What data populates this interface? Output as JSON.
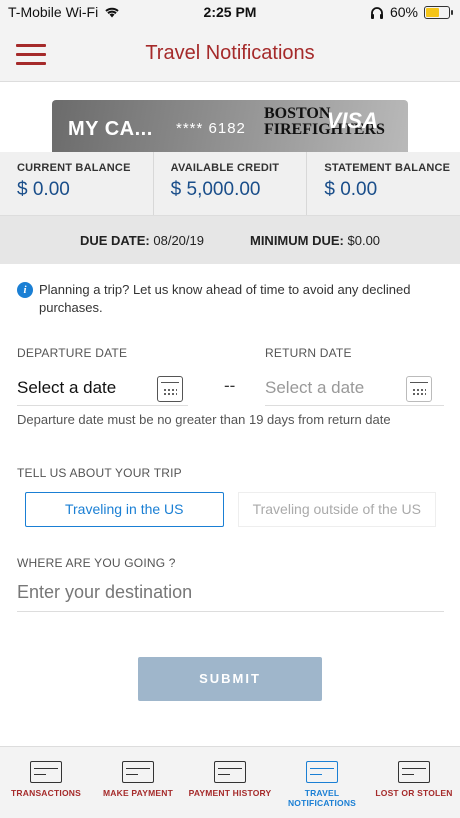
{
  "status_bar": {
    "carrier": "T-Mobile Wi-Fi",
    "time": "2:25 PM",
    "battery": "60%",
    "battery_fill": 0.6
  },
  "header": {
    "title": "Travel Notifications"
  },
  "card": {
    "name": "MY CA...",
    "number": "**** 6182",
    "brand_line1": "BOSTON",
    "brand_line2": "FIREFIGHTERS",
    "network": "VISA"
  },
  "balances": [
    {
      "label": "CURRENT BALANCE",
      "value": "$ 0.00"
    },
    {
      "label": "AVAILABLE CREDIT",
      "value": "$ 5,000.00"
    },
    {
      "label": "STATEMENT BALANCE",
      "value": "$ 0.00"
    }
  ],
  "due": {
    "due_label": "DUE DATE:",
    "due_value": "08/20/19",
    "min_label": "MINIMUM DUE:",
    "min_value": "$0.00"
  },
  "info_text": "Planning a trip? Let us know ahead of time to avoid any declined purchases.",
  "departure": {
    "label": "DEPARTURE DATE",
    "value": "Select a date"
  },
  "return": {
    "label": "RETURN DATE",
    "placeholder": "Select a date"
  },
  "separator": "--",
  "hint": "Departure date must be no greater than 19 days from return date",
  "trip": {
    "label": "TELL US ABOUT YOUR TRIP",
    "options": [
      "Traveling in the US",
      "Traveling outside of the US"
    ],
    "selected": 0
  },
  "destination": {
    "label": "WHERE ARE YOU GOING ?",
    "placeholder": "Enter your destination"
  },
  "submit_label": "SUBMIT",
  "tabbar": [
    {
      "label": "TRANSACTIONS",
      "icon": "transactions-icon"
    },
    {
      "label": "MAKE PAYMENT",
      "icon": "payment-icon"
    },
    {
      "label": "PAYMENT HISTORY",
      "icon": "history-icon"
    },
    {
      "label": "TRAVEL NOTIFICATIONS",
      "icon": "travel-icon",
      "active": true
    },
    {
      "label": "LOST OR STOLEN",
      "icon": "warning-icon"
    }
  ],
  "colors": {
    "brand": "#a52a2a",
    "accent": "#1a7fd4",
    "value_blue": "#1a4e8a",
    "submit": "#9fb6cb"
  }
}
